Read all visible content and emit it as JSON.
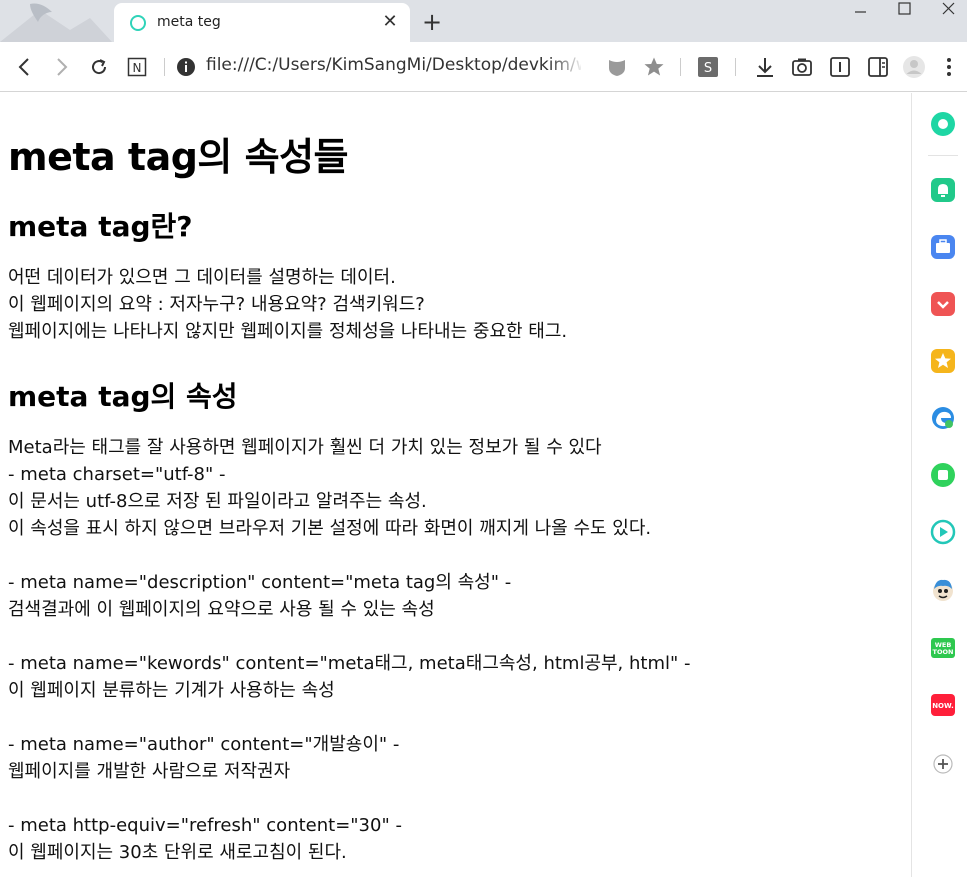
{
  "browser": {
    "tab": {
      "title": "meta teg"
    },
    "new_tab_label": "+",
    "close_tab_label": "✕",
    "address": "file:///C:/Users/KimSangMi/Desktop/devkim/web",
    "ext_s_label": "S",
    "ext_n_label": "N",
    "accent": "#2fd3b9"
  },
  "page": {
    "h1": "meta tag의 속성들",
    "section1": {
      "heading": "meta tag란?",
      "lines": [
        "어떤 데이터가 있으면 그 데이터를 설명하는 데이터.",
        "이 웹페이지의 요약 : 저자누구? 내용요약? 검색키워드?",
        "웹페이지에는 나타나지 않지만 웹페이지를 정체성을 나타내는 중요한 태그."
      ]
    },
    "section2": {
      "heading": "meta tag의 속성",
      "lines": [
        "Meta라는 태그를 잘 사용하면 웹페이지가 훨씬 더 가치 있는 정보가 될 수 있다",
        " - meta charset=\"utf-8\" -",
        "이 문서는 utf-8으로 저장 된 파일이라고 알려주는 속성.",
        "이 속성을 표시 하지 않으면 브라우저 기본 설정에 따라 화면이 깨지게 나올 수도 있다.",
        "- meta name=\"description\" content=\"meta tag의 속성\" -",
        "검색결과에 이 웹페이지의 요약으로 사용 될 수 있는 속성",
        "- meta name=\"kewords\" content=\"meta태그, meta태그속성, html공부, html\" -",
        "이 웹페이지 분류하는 기계가 사용하는 속성",
        "- meta name=\"author\" content=\"개발숑이\" -",
        "웹페이지를 개발한 사람으로 저작권자",
        "- meta http-equiv=\"refresh\" content=\"30\" -",
        "이 웹페이지는 30초 단위로 새로고침이 된다."
      ]
    }
  },
  "sidebar": {
    "items": [
      {
        "icon": "green-circle-icon",
        "color": "#1ed6a4"
      },
      {
        "icon": "bell-icon",
        "color": "#21c98a"
      },
      {
        "icon": "briefcase-icon",
        "color": "#4a86f0"
      },
      {
        "icon": "pocket-icon",
        "color": "#ef5454"
      },
      {
        "icon": "star-icon",
        "color": "#f5b51c"
      },
      {
        "icon": "edge-icon",
        "color": "#2b8de3"
      },
      {
        "icon": "square-icon",
        "color": "#2fd25c"
      },
      {
        "icon": "play-icon",
        "color": "#22c7b8"
      },
      {
        "icon": "cartoon-character-icon",
        "color": "#3a8fd8"
      },
      {
        "icon": "webtoon-icon",
        "color": "#2ec84f",
        "label": "WEB TOON"
      },
      {
        "icon": "now-icon",
        "color": "#ff1f3a",
        "label": "NOW."
      },
      {
        "icon": "plus-icon",
        "color": "#555555"
      }
    ]
  }
}
